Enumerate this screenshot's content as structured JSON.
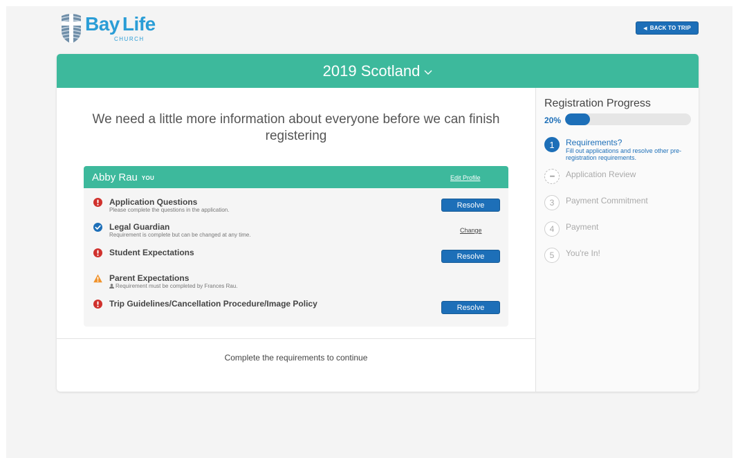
{
  "brand": {
    "name_part1": "Bay",
    "name_part2": "Life",
    "tagline": "CHURCH",
    "color": "#2a9dd6"
  },
  "header": {
    "back_button_label": "BACK TO TRIP"
  },
  "trip": {
    "title": "2019 Scotland",
    "accent_color": "#3db99c"
  },
  "main": {
    "headline": "We need a little more information about everyone before we can finish registering",
    "continue_message": "Complete the requirements to continue"
  },
  "person": {
    "name": "Abby Rau",
    "tag": "YOU",
    "edit_profile_label": "Edit Profile",
    "requirements": [
      {
        "status": "error",
        "icon": "exclamation-circle-icon",
        "title": "Application Questions",
        "subtitle": "Please complete the questions in the application.",
        "action": "Resolve"
      },
      {
        "status": "complete",
        "icon": "check-circle-icon",
        "title": "Legal Guardian",
        "subtitle": "Requirement is complete but can be changed at any time.",
        "action": "Change"
      },
      {
        "status": "error",
        "icon": "exclamation-circle-icon",
        "title": "Student Expectations",
        "subtitle": "",
        "action": "Resolve"
      },
      {
        "status": "warning",
        "icon": "warning-triangle-icon",
        "title": "Parent Expectations",
        "subtitle": "Requirement must be completed by Frances Rau.",
        "action": ""
      },
      {
        "status": "error",
        "icon": "exclamation-circle-icon",
        "title": "Trip Guidelines/Cancellation Procedure/Image Policy",
        "subtitle": "",
        "action": "Resolve"
      }
    ]
  },
  "progress": {
    "title": "Registration Progress",
    "percent_label": "20%",
    "percent_value": 20,
    "steps": [
      {
        "num": "1",
        "label": "Requirements?",
        "desc": "Fill out applications and resolve other pre-registration requirements.",
        "state": "active"
      },
      {
        "num": "•••",
        "label": "Application Review",
        "desc": "",
        "state": "pending"
      },
      {
        "num": "3",
        "label": "Payment Commitment",
        "desc": "",
        "state": "inactive"
      },
      {
        "num": "4",
        "label": "Payment",
        "desc": "",
        "state": "inactive"
      },
      {
        "num": "5",
        "label": "You're In!",
        "desc": "",
        "state": "inactive"
      }
    ]
  },
  "colors": {
    "primary_blue": "#1d6fb8",
    "error_red": "#d0312d",
    "warning_orange": "#f0922b",
    "check_blue": "#1d6fb8"
  }
}
